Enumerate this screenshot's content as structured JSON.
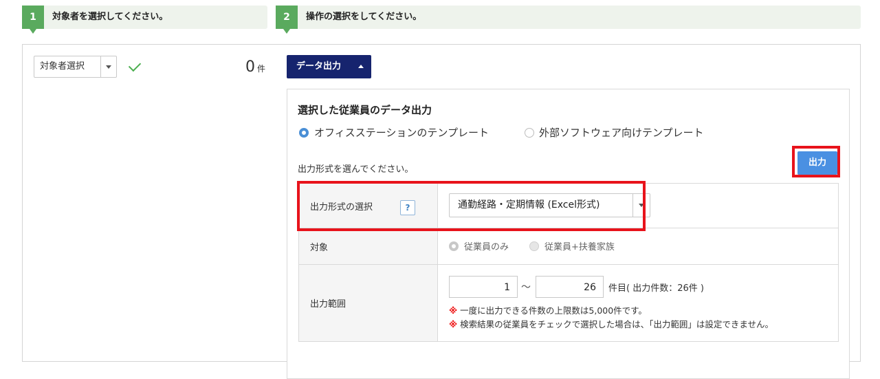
{
  "steps": [
    {
      "num": "1",
      "label": "対象者を選択してください。"
    },
    {
      "num": "2",
      "label": "操作の選択をしてください。"
    }
  ],
  "left": {
    "select_label": "対象者選択",
    "count": "0",
    "count_unit": "件"
  },
  "right": {
    "data_button": "データ出力",
    "section_title": "選択した従業員のデータ出力",
    "template_options": [
      {
        "label": "オフィスステーションのテンプレート",
        "selected": true
      },
      {
        "label": "外部ソフトウェア向けテンプレート",
        "selected": false
      }
    ],
    "hint": "出力形式を選んでください。",
    "output_button": "出力",
    "rows": {
      "format": {
        "label": "出力形式の選択",
        "help": "?",
        "value": "通勤経路・定期情報 (Excel形式)"
      },
      "target": {
        "label": "対象",
        "options": [
          {
            "label": "従業員のみ",
            "selected": true
          },
          {
            "label": "従業員+扶養家族",
            "selected": false
          }
        ]
      },
      "range": {
        "label": "出力範囲",
        "from": "1",
        "tilde": "〜",
        "to": "26",
        "suffix": "件目( 出力件数：26件 )",
        "note_mark": "※",
        "note1": "一度に出力できる件数の上限数は5,000件です。",
        "note2": "検索結果の従業員をチェックで選択した場合は、「出力範囲」は設定できません。"
      }
    }
  },
  "colors": {
    "step_green": "#5aaa5e",
    "navy": "#16246e",
    "blue": "#4a90e2",
    "highlight_red": "#e8131b"
  }
}
